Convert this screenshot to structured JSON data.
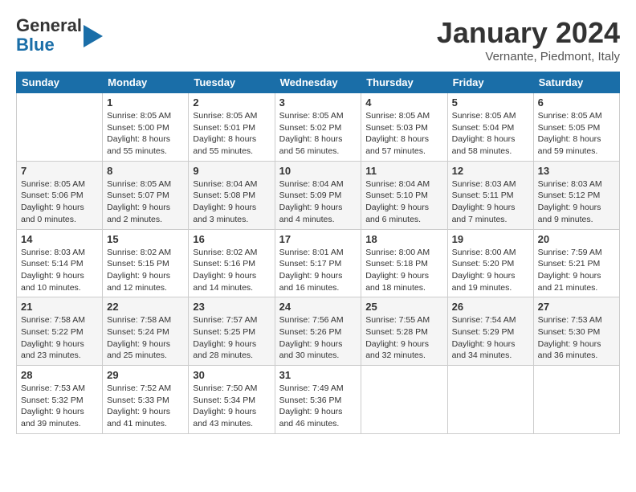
{
  "header": {
    "logo_general": "General",
    "logo_blue": "Blue",
    "month_title": "January 2024",
    "location": "Vernante, Piedmont, Italy"
  },
  "weekdays": [
    "Sunday",
    "Monday",
    "Tuesday",
    "Wednesday",
    "Thursday",
    "Friday",
    "Saturday"
  ],
  "weeks": [
    [
      {
        "day": "",
        "info": ""
      },
      {
        "day": "1",
        "info": "Sunrise: 8:05 AM\nSunset: 5:00 PM\nDaylight: 8 hours\nand 55 minutes."
      },
      {
        "day": "2",
        "info": "Sunrise: 8:05 AM\nSunset: 5:01 PM\nDaylight: 8 hours\nand 55 minutes."
      },
      {
        "day": "3",
        "info": "Sunrise: 8:05 AM\nSunset: 5:02 PM\nDaylight: 8 hours\nand 56 minutes."
      },
      {
        "day": "4",
        "info": "Sunrise: 8:05 AM\nSunset: 5:03 PM\nDaylight: 8 hours\nand 57 minutes."
      },
      {
        "day": "5",
        "info": "Sunrise: 8:05 AM\nSunset: 5:04 PM\nDaylight: 8 hours\nand 58 minutes."
      },
      {
        "day": "6",
        "info": "Sunrise: 8:05 AM\nSunset: 5:05 PM\nDaylight: 8 hours\nand 59 minutes."
      }
    ],
    [
      {
        "day": "7",
        "info": "Sunrise: 8:05 AM\nSunset: 5:06 PM\nDaylight: 9 hours\nand 0 minutes."
      },
      {
        "day": "8",
        "info": "Sunrise: 8:05 AM\nSunset: 5:07 PM\nDaylight: 9 hours\nand 2 minutes."
      },
      {
        "day": "9",
        "info": "Sunrise: 8:04 AM\nSunset: 5:08 PM\nDaylight: 9 hours\nand 3 minutes."
      },
      {
        "day": "10",
        "info": "Sunrise: 8:04 AM\nSunset: 5:09 PM\nDaylight: 9 hours\nand 4 minutes."
      },
      {
        "day": "11",
        "info": "Sunrise: 8:04 AM\nSunset: 5:10 PM\nDaylight: 9 hours\nand 6 minutes."
      },
      {
        "day": "12",
        "info": "Sunrise: 8:03 AM\nSunset: 5:11 PM\nDaylight: 9 hours\nand 7 minutes."
      },
      {
        "day": "13",
        "info": "Sunrise: 8:03 AM\nSunset: 5:12 PM\nDaylight: 9 hours\nand 9 minutes."
      }
    ],
    [
      {
        "day": "14",
        "info": "Sunrise: 8:03 AM\nSunset: 5:14 PM\nDaylight: 9 hours\nand 10 minutes."
      },
      {
        "day": "15",
        "info": "Sunrise: 8:02 AM\nSunset: 5:15 PM\nDaylight: 9 hours\nand 12 minutes."
      },
      {
        "day": "16",
        "info": "Sunrise: 8:02 AM\nSunset: 5:16 PM\nDaylight: 9 hours\nand 14 minutes."
      },
      {
        "day": "17",
        "info": "Sunrise: 8:01 AM\nSunset: 5:17 PM\nDaylight: 9 hours\nand 16 minutes."
      },
      {
        "day": "18",
        "info": "Sunrise: 8:00 AM\nSunset: 5:18 PM\nDaylight: 9 hours\nand 18 minutes."
      },
      {
        "day": "19",
        "info": "Sunrise: 8:00 AM\nSunset: 5:20 PM\nDaylight: 9 hours\nand 19 minutes."
      },
      {
        "day": "20",
        "info": "Sunrise: 7:59 AM\nSunset: 5:21 PM\nDaylight: 9 hours\nand 21 minutes."
      }
    ],
    [
      {
        "day": "21",
        "info": "Sunrise: 7:58 AM\nSunset: 5:22 PM\nDaylight: 9 hours\nand 23 minutes."
      },
      {
        "day": "22",
        "info": "Sunrise: 7:58 AM\nSunset: 5:24 PM\nDaylight: 9 hours\nand 25 minutes."
      },
      {
        "day": "23",
        "info": "Sunrise: 7:57 AM\nSunset: 5:25 PM\nDaylight: 9 hours\nand 28 minutes."
      },
      {
        "day": "24",
        "info": "Sunrise: 7:56 AM\nSunset: 5:26 PM\nDaylight: 9 hours\nand 30 minutes."
      },
      {
        "day": "25",
        "info": "Sunrise: 7:55 AM\nSunset: 5:28 PM\nDaylight: 9 hours\nand 32 minutes."
      },
      {
        "day": "26",
        "info": "Sunrise: 7:54 AM\nSunset: 5:29 PM\nDaylight: 9 hours\nand 34 minutes."
      },
      {
        "day": "27",
        "info": "Sunrise: 7:53 AM\nSunset: 5:30 PM\nDaylight: 9 hours\nand 36 minutes."
      }
    ],
    [
      {
        "day": "28",
        "info": "Sunrise: 7:53 AM\nSunset: 5:32 PM\nDaylight: 9 hours\nand 39 minutes."
      },
      {
        "day": "29",
        "info": "Sunrise: 7:52 AM\nSunset: 5:33 PM\nDaylight: 9 hours\nand 41 minutes."
      },
      {
        "day": "30",
        "info": "Sunrise: 7:50 AM\nSunset: 5:34 PM\nDaylight: 9 hours\nand 43 minutes."
      },
      {
        "day": "31",
        "info": "Sunrise: 7:49 AM\nSunset: 5:36 PM\nDaylight: 9 hours\nand 46 minutes."
      },
      {
        "day": "",
        "info": ""
      },
      {
        "day": "",
        "info": ""
      },
      {
        "day": "",
        "info": ""
      }
    ]
  ]
}
